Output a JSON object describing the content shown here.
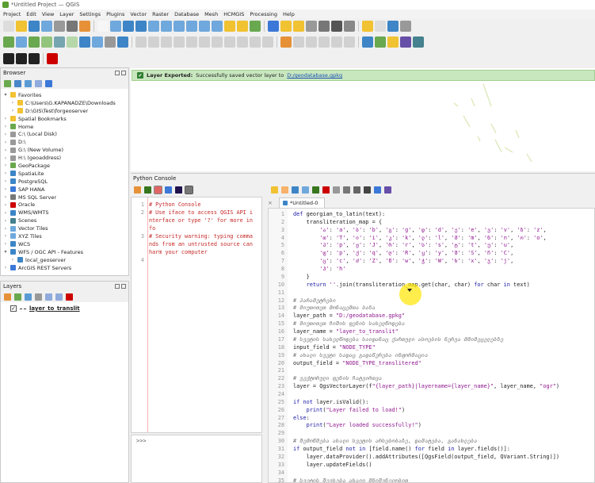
{
  "window": {
    "title": "*Untitled Project — QGIS"
  },
  "menu": [
    "Project",
    "Edit",
    "View",
    "Layer",
    "Settings",
    "Plugins",
    "Vector",
    "Raster",
    "Database",
    "Mesh",
    "HCMGIS",
    "Processing",
    "Help"
  ],
  "message_bar": {
    "title": "Layer Exported:",
    "text": "Successfully saved vector layer to",
    "link": "D:/geodatabase.gpkg"
  },
  "browser": {
    "title": "Browser",
    "items": [
      {
        "label": "Favorites",
        "indent": 0,
        "expanded": true
      },
      {
        "label": "C:\\Users\\G.KAPANADZE\\Downloads",
        "indent": 1
      },
      {
        "label": "D:\\GIS\\Test\\forgeoserver",
        "indent": 1
      },
      {
        "label": "Spatial Bookmarks",
        "indent": 0
      },
      {
        "label": "Home",
        "indent": 0
      },
      {
        "label": "C:\\ (Local Disk)",
        "indent": 0
      },
      {
        "label": "D:\\",
        "indent": 0
      },
      {
        "label": "G:\\ (New Volume)",
        "indent": 0
      },
      {
        "label": "H:\\ (geoaddress)",
        "indent": 0
      },
      {
        "label": "GeoPackage",
        "indent": 0
      },
      {
        "label": "SpatiaLite",
        "indent": 0
      },
      {
        "label": "PostgreSQL",
        "indent": 0
      },
      {
        "label": "SAP HANA",
        "indent": 0
      },
      {
        "label": "MS SQL Server",
        "indent": 0
      },
      {
        "label": "Oracle",
        "indent": 0
      },
      {
        "label": "WMS/WMTS",
        "indent": 0
      },
      {
        "label": "Scenes",
        "indent": 0
      },
      {
        "label": "Vector Tiles",
        "indent": 0
      },
      {
        "label": "XYZ Tiles",
        "indent": 0
      },
      {
        "label": "WCS",
        "indent": 0
      },
      {
        "label": "WFS / OGC API - Features",
        "indent": 0,
        "expanded": true
      },
      {
        "label": "local_geoserver",
        "indent": 1
      },
      {
        "label": "ArcGIS REST Servers",
        "indent": 0
      }
    ]
  },
  "layers": {
    "title": "Layers",
    "items": [
      {
        "label": "layer_to_translit",
        "checked": true
      }
    ]
  },
  "python_console": {
    "title": "Python Console",
    "output": [
      "# Python Console",
      "# Use iface to access QGIS API i",
      "nterface or type '?' for more in",
      "fo",
      "# Security warning: typing comma",
      "nds from an untrusted source can",
      " harm your computer"
    ],
    "output_line_numbers": [
      "1",
      "2",
      "3",
      "4"
    ],
    "prompt": ">>>",
    "editor_tab": "*Untitled-0"
  },
  "editor": {
    "lines": [
      {
        "n": "1",
        "t": "def georgian_to_latin(text):"
      },
      {
        "n": "2",
        "t": "    transliteration_map = {"
      },
      {
        "n": "3",
        "t": "        'ა': 'a', 'ბ': 'b', 'გ': 'g', 'დ': 'd', 'ე': 'e', 'ვ': 'v', 'ზ': 'z',"
      },
      {
        "n": "4",
        "t": "        'თ': 'T', 'ი': 'i', 'კ': 'k', 'ლ': 'l', 'მ': 'm', 'ნ': 'n', 'ო': 'o',"
      },
      {
        "n": "5",
        "t": "        'პ': 'p', 'ჟ': 'J', 'რ': 'r', 'ს': 's', 'ტ': 't', 'უ': 'u',"
      },
      {
        "n": "6",
        "t": "        'ფ': 'p', 'ქ': 'q', 'ღ': 'R', 'ყ': 'y', 'შ': 'S', 'ჩ': 'C',"
      },
      {
        "n": "7",
        "t": "        'ც': 'c', 'ძ': 'Z', 'წ': 'w', 'ჭ': 'W', 'ხ': 'x', 'ჯ': 'j',"
      },
      {
        "n": "8",
        "t": "        'ჰ': 'h'"
      },
      {
        "n": "9",
        "t": "    }"
      },
      {
        "n": "10",
        "t": "    return ''.join(transliteration_map.get(char, char) for char in text)"
      },
      {
        "n": "11",
        "t": ""
      },
      {
        "n": "12",
        "t": "# პარამეტრები"
      },
      {
        "n": "13",
        "t": "# მიუთითეთ მონაცემთა ბაზა"
      },
      {
        "n": "14",
        "t": "layer_path = \"D:/geodatabase.gpkg\""
      },
      {
        "n": "15",
        "t": "# მიუთითეთ ჩიშის ფენის სახელწოდება"
      },
      {
        "n": "16",
        "t": "layer_name = \"layer_to_translit\""
      },
      {
        "n": "17",
        "t": "# სვეტის სახელწოდება საიდანაც ქართული ასოების ნერვა მმიმეცელებზე"
      },
      {
        "n": "18",
        "t": "input_field = \"NODE_TYPE\""
      },
      {
        "n": "19",
        "t": "# ახალი სვეტი სადაც გადაწერება ინფორმაცია"
      },
      {
        "n": "20",
        "t": "output_field = \"NODE_TYPE_translitered\""
      },
      {
        "n": "21",
        "t": ""
      },
      {
        "n": "22",
        "t": "# ვექტორული ფენის ჩატვირთვა"
      },
      {
        "n": "23",
        "t": "layer = QgsVectorLayer(f\"{layer_path}|layername={layer_name}\", layer_name, \"ogr\")"
      },
      {
        "n": "24",
        "t": ""
      },
      {
        "n": "25",
        "t": "if not layer.isValid():"
      },
      {
        "n": "26",
        "t": "    print(\"Layer failed to load!\")"
      },
      {
        "n": "27",
        "t": "else:"
      },
      {
        "n": "28",
        "t": "    print(\"Layer loaded successfully!\")"
      },
      {
        "n": "29",
        "t": ""
      },
      {
        "n": "30",
        "t": "# შემოწმება ახალი სვეტის არსებობაზე, დამატება, განახლება"
      },
      {
        "n": "31",
        "t": "if output_field not in [field.name() for field in layer.fields()]:"
      },
      {
        "n": "32",
        "t": "    layer.dataProvider().addAttributes([QgsField(output_field, QVariant.String)])"
      },
      {
        "n": "33",
        "t": "    layer.updateFields()"
      },
      {
        "n": "34",
        "t": ""
      },
      {
        "n": "35",
        "t": "# სვეტის შევსება ახალი მნიშვნელობით"
      }
    ]
  },
  "colors": {
    "accent": "#5a9e2f",
    "msg_bg": "#c8e7bf",
    "cursor_highlight": "#ffe600",
    "keyword": "#1a1aa6",
    "string": "#8f1a8f",
    "console_text": "#c62828"
  }
}
